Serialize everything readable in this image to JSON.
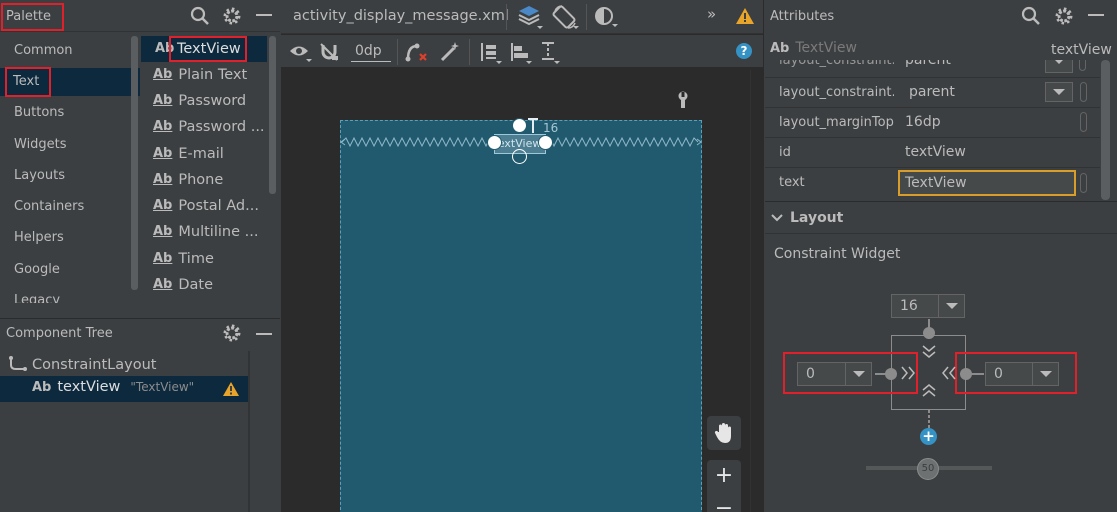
{
  "palette": {
    "title": "Palette",
    "categories": [
      "Common",
      "Text",
      "Buttons",
      "Widgets",
      "Layouts",
      "Containers",
      "Helpers",
      "Google",
      "Legacy"
    ],
    "items": [
      {
        "icon": "Ab",
        "label": "TextView"
      },
      {
        "icon": "Ab",
        "label": "Plain Text"
      },
      {
        "icon": "Ab",
        "label": "Password"
      },
      {
        "icon": "Ab",
        "label": "Password ..."
      },
      {
        "icon": "Ab",
        "label": "E-mail"
      },
      {
        "icon": "Ab",
        "label": "Phone"
      },
      {
        "icon": "Ab",
        "label": "Postal Ad..."
      },
      {
        "icon": "Ab",
        "label": "Multiline ..."
      },
      {
        "icon": "Ab",
        "label": "Time"
      },
      {
        "icon": "Ab",
        "label": "Date"
      }
    ]
  },
  "component_tree": {
    "title": "Component Tree",
    "root": "ConstraintLayout",
    "child_icon": "Ab",
    "child_name": "textView",
    "child_text": "\"TextView\""
  },
  "editor": {
    "file_tab": "activity_display_message.xml",
    "more": "»",
    "margin_value": "0dp",
    "canvas_label_margin": "16",
    "canvas_widget_text": "TextView",
    "zoom_in": "+",
    "zoom_out": "−"
  },
  "attributes": {
    "title": "Attributes",
    "widget_icon": "Ab",
    "widget_type": "TextView",
    "widget_id": "textView",
    "rows": [
      {
        "name": "layout_constraint...",
        "value": "parent"
      },
      {
        "name": "layout_constraint...",
        "value": "parent"
      },
      {
        "name": "layout_marginTop",
        "value": "16dp"
      },
      {
        "name": "id",
        "value": "textView"
      },
      {
        "name": "text",
        "value": "TextView"
      }
    ],
    "layout_section": "Layout",
    "constraint_widget": "Constraint Widget",
    "top_margin": "16",
    "left_margin": "0",
    "right_margin": "0",
    "bias": "50"
  },
  "colors": {
    "background": "#3c3f41",
    "canvas": "#215a6e",
    "accent": "#4a88c7",
    "warning": "#e8a52a",
    "highlight": "#e0202a"
  }
}
